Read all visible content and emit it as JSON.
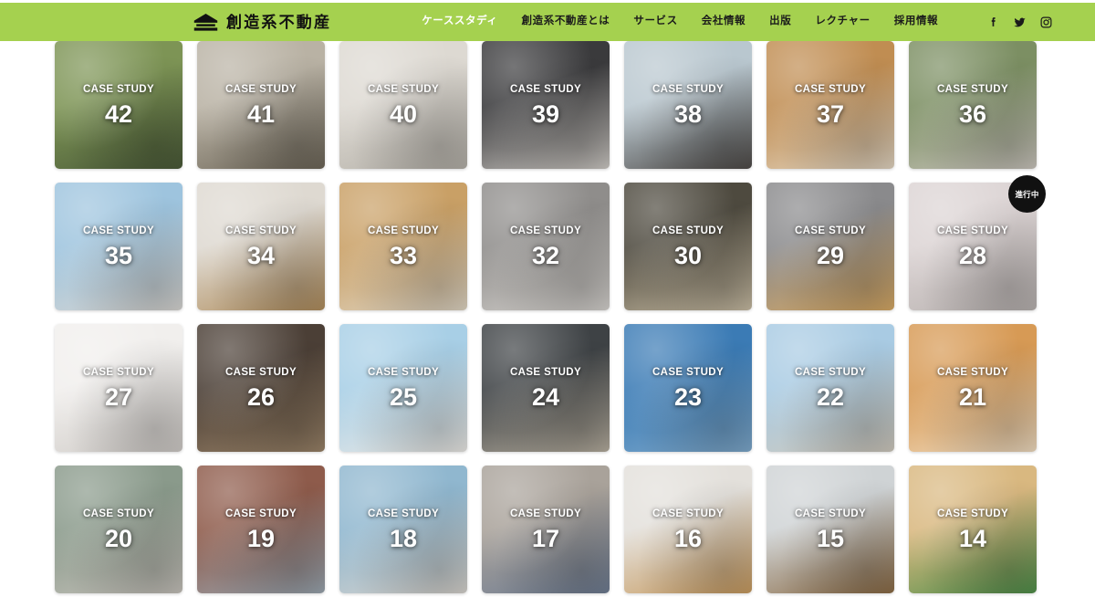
{
  "header": {
    "brand_name": "創造系不動産",
    "brand_icon": "house-logo-icon",
    "background_color": "#a5d14f",
    "nav_items": [
      {
        "label": "ケーススタディ",
        "active": true
      },
      {
        "label": "創造系不動産とは",
        "active": false
      },
      {
        "label": "サービス",
        "active": false
      },
      {
        "label": "会社情報",
        "active": false
      },
      {
        "label": "出版",
        "active": false
      },
      {
        "label": "レクチャー",
        "active": false
      },
      {
        "label": "採用情報",
        "active": false
      }
    ],
    "social": [
      {
        "name": "facebook-icon"
      },
      {
        "name": "twitter-icon"
      },
      {
        "name": "instagram-icon"
      }
    ]
  },
  "gallery": {
    "kicker": "CASE STUDY",
    "badge_label": "進行中",
    "rows": [
      [
        {
          "number": "42",
          "tone_a": "#7d9455",
          "tone_b": "#4a5a38",
          "badge": false
        },
        {
          "number": "41",
          "tone_a": "#b9b2a4",
          "tone_b": "#6d6658",
          "badge": false
        },
        {
          "number": "40",
          "tone_a": "#ddd9d2",
          "tone_b": "#b4b0a8",
          "badge": false
        },
        {
          "number": "39",
          "tone_a": "#3a3a3c",
          "tone_b": "#cfcbc6",
          "badge": false
        },
        {
          "number": "38",
          "tone_a": "#b9c7cf",
          "tone_b": "#4e4a47",
          "badge": false
        },
        {
          "number": "37",
          "tone_a": "#c08d52",
          "tone_b": "#e3d6c2",
          "badge": false
        },
        {
          "number": "36",
          "tone_a": "#7c8f63",
          "tone_b": "#cac5bd",
          "badge": false
        }
      ],
      [
        {
          "number": "35",
          "tone_a": "#9ec4de",
          "tone_b": "#d8d6d2",
          "badge": false
        },
        {
          "number": "34",
          "tone_a": "#ded9d1",
          "tone_b": "#b08d5c",
          "badge": false
        },
        {
          "number": "33",
          "tone_a": "#c9a066",
          "tone_b": "#e0d6c4",
          "badge": false
        },
        {
          "number": "32",
          "tone_a": "#8f8d8b",
          "tone_b": "#d6d3cf",
          "badge": false
        },
        {
          "number": "30",
          "tone_a": "#4e4a3f",
          "tone_b": "#c9bda4",
          "badge": false
        },
        {
          "number": "29",
          "tone_a": "#8a8a8c",
          "tone_b": "#d7a964",
          "badge": false
        },
        {
          "number": "28",
          "tone_a": "#dcd4d4",
          "tone_b": "#b8b2b0",
          "badge": true
        }
      ],
      [
        {
          "number": "27",
          "tone_a": "#f1efed",
          "tone_b": "#cfcbc7",
          "badge": false
        },
        {
          "number": "26",
          "tone_a": "#4b3f36",
          "tone_b": "#9a8368",
          "badge": false
        },
        {
          "number": "25",
          "tone_a": "#a8cfe6",
          "tone_b": "#ebe9e5",
          "badge": false
        },
        {
          "number": "24",
          "tone_a": "#3e4245",
          "tone_b": "#b6ae9f",
          "badge": false
        },
        {
          "number": "23",
          "tone_a": "#3b7bb5",
          "tone_b": "#7ea9cc",
          "badge": false
        },
        {
          "number": "22",
          "tone_a": "#a9cbe3",
          "tone_b": "#cfc9bd",
          "badge": false
        },
        {
          "number": "21",
          "tone_a": "#d79a55",
          "tone_b": "#f0dcc0",
          "badge": false
        }
      ],
      [
        {
          "number": "20",
          "tone_a": "#8a9a8b",
          "tone_b": "#c6c2bb",
          "badge": false
        },
        {
          "number": "19",
          "tone_a": "#8e5b4b",
          "tone_b": "#9aa6b0",
          "badge": false
        },
        {
          "number": "18",
          "tone_a": "#90b7cf",
          "tone_b": "#d7d3cd",
          "badge": false
        },
        {
          "number": "17",
          "tone_a": "#a9a29a",
          "tone_b": "#6e7c92",
          "badge": false
        },
        {
          "number": "16",
          "tone_a": "#e3e0db",
          "tone_b": "#c79a5e",
          "badge": false
        },
        {
          "number": "15",
          "tone_a": "#cfd3d5",
          "tone_b": "#8a6a44",
          "badge": false
        },
        {
          "number": "14",
          "tone_a": "#d9b880",
          "tone_b": "#4f8f4a",
          "badge": false
        }
      ]
    ]
  }
}
